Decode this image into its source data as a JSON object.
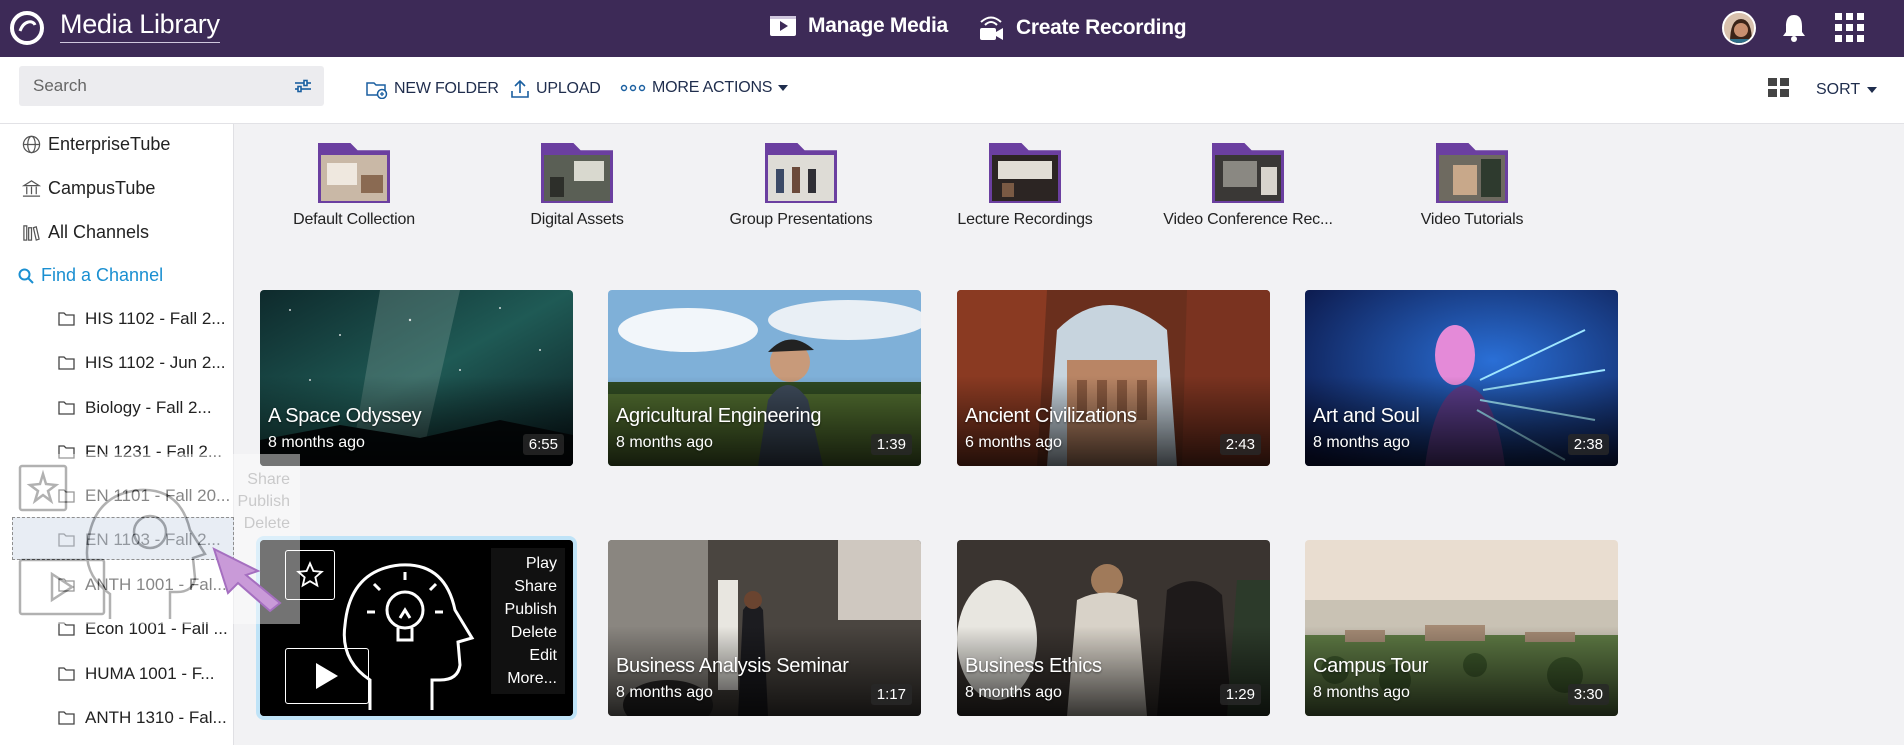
{
  "header": {
    "app_title": "Media Library",
    "nav": [
      {
        "label": "Manage Media",
        "icon": "media-player-icon"
      },
      {
        "label": "Create Recording",
        "icon": "recording-camera-icon"
      }
    ],
    "colors": {
      "bar": "#3d2a57",
      "accent": "#6b3fa0"
    }
  },
  "toolbar": {
    "search_placeholder": "Search",
    "new_folder": "NEW FOLDER",
    "upload": "UPLOAD",
    "more_actions": "MORE ACTIONS",
    "sort": "SORT"
  },
  "sidebar": {
    "top_items": [
      {
        "label": "EnterpriseTube",
        "icon": "globe-icon"
      },
      {
        "label": "CampusTube",
        "icon": "building-icon"
      },
      {
        "label": "All Channels",
        "icon": "library-icon"
      }
    ],
    "find_channel": "Find a Channel",
    "channels": [
      "HIS 1102 - Fall 2...",
      "HIS 1102 - Jun 2...",
      "Biology - Fall 2...",
      "EN 1231 - Fall 2...",
      "EN 1101 - Fall 20...",
      "EN 1103 - Fall 2...",
      "ANTH 1001 - Fal...",
      "Econ 1001 - Fall ...",
      "HUMA 1001 - F...",
      "ANTH 1310 - Fal..."
    ]
  },
  "folders": [
    {
      "name": "Default Collection"
    },
    {
      "name": "Digital Assets"
    },
    {
      "name": "Group Presentations"
    },
    {
      "name": "Lecture Recordings"
    },
    {
      "name": "Video Conference Rec..."
    },
    {
      "name": "Video Tutorials"
    }
  ],
  "media": [
    {
      "title": "A Space Odyssey",
      "date": "8 months ago",
      "duration": "6:55"
    },
    {
      "title": "Agricultural Engineering",
      "date": "8 months ago",
      "duration": "1:39"
    },
    {
      "title": "Ancient Civilizations",
      "date": "6 months ago",
      "duration": "2:43"
    },
    {
      "title": "Art and Soul",
      "date": "8 months ago",
      "duration": "2:38"
    },
    {
      "title": "Business Analysis Seminar",
      "date": "8 months ago",
      "duration": "1:17"
    },
    {
      "title": "Business Ethics",
      "date": "8 months ago",
      "duration": "1:29"
    },
    {
      "title": "Campus Tour",
      "date": "8 months ago",
      "duration": "3:30"
    }
  ],
  "hover_actions": [
    "Play",
    "Share",
    "Publish",
    "Delete",
    "Edit",
    "More..."
  ]
}
